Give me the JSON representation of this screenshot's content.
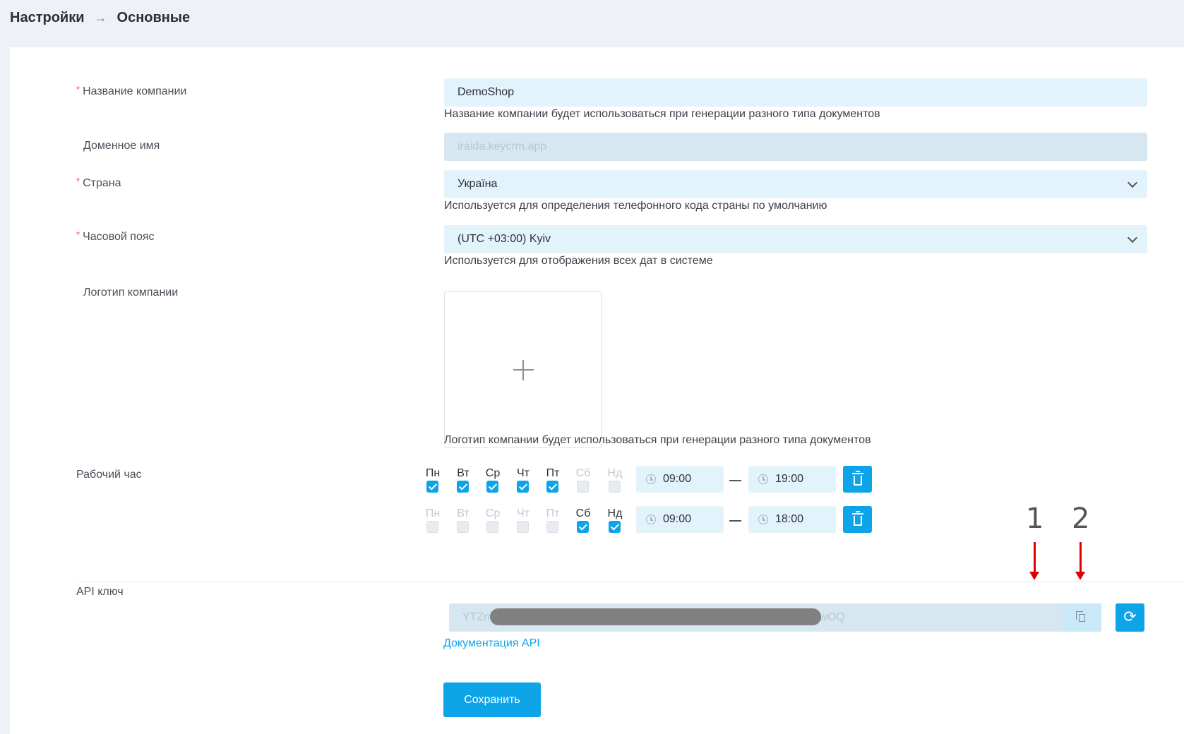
{
  "breadcrumb": {
    "parent": "Настройки",
    "separator": "→",
    "current": "Основные"
  },
  "form": {
    "company_name": {
      "required_mark": "*",
      "label": "Название компании",
      "value": "DemoShop",
      "hint": "Название компании будет использоваться при генерации разного типа документов"
    },
    "domain": {
      "label": "Доменное имя",
      "value": "iraida.keycrm.app"
    },
    "country": {
      "required_mark": "*",
      "label": "Страна",
      "value": "Україна",
      "hint": "Используется для определения телефонного кода страны по умолчанию"
    },
    "timezone": {
      "required_mark": "*",
      "label": "Часовой пояс",
      "value": "(UTC +03:00) Kyiv",
      "hint": "Используется для отображения всех дат в системе"
    },
    "logo": {
      "label": "Логотип компании",
      "hint": "Логотип компании будет использоваться при генерации разного типа документов"
    },
    "working_hours": {
      "label": "Рабочий час",
      "rows": [
        {
          "days": [
            {
              "name": "Пн",
              "checked": true
            },
            {
              "name": "Вт",
              "checked": true
            },
            {
              "name": "Ср",
              "checked": true
            },
            {
              "name": "Чт",
              "checked": true
            },
            {
              "name": "Пт",
              "checked": true
            },
            {
              "name": "Сб",
              "checked": false
            },
            {
              "name": "Нд",
              "checked": false
            }
          ],
          "from": "09:00",
          "to": "19:00"
        },
        {
          "days": [
            {
              "name": "Пн",
              "checked": false
            },
            {
              "name": "Вт",
              "checked": false
            },
            {
              "name": "Ср",
              "checked": false
            },
            {
              "name": "Чт",
              "checked": false
            },
            {
              "name": "Пт",
              "checked": false
            },
            {
              "name": "Сб",
              "checked": true
            },
            {
              "name": "Нд",
              "checked": true
            }
          ],
          "from": "09:00",
          "to": "18:00"
        }
      ]
    },
    "api_key": {
      "label": "API ключ",
      "value_prefix": "YTZm",
      "value_suffix": "wOQ",
      "docs_link": "Документация API"
    },
    "save_label": "Сохранить"
  },
  "annotations": {
    "marker_1": "1",
    "marker_2": "2"
  },
  "colors": {
    "accent": "#0ea4e8",
    "field_bg": "#e3f3fc",
    "required": "#e65050",
    "annotation_arrow": "#e00000"
  }
}
